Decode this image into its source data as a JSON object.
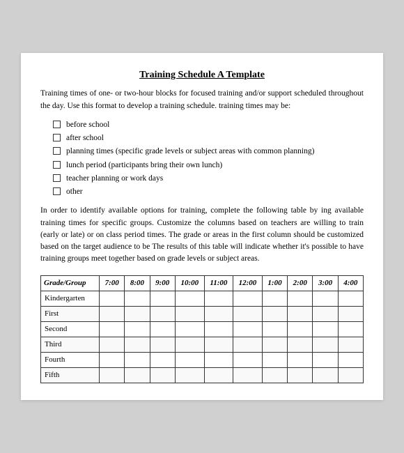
{
  "title": "Training Schedule A Template",
  "intro": "Training times of one- or two-hour blocks for focused training and/or support scheduled throughout the day. Use this format to develop a training schedule. training times may be:",
  "checklist": [
    "before school",
    "after school",
    "planning times (specific grade levels or subject areas with common planning)",
    "lunch period (participants bring their own lunch)",
    "teacher planning or work days",
    "other"
  ],
  "body": "In order to identify available options for training, complete the following table by ing available training times for specific groups. Customize the columns based on teachers are willing to train (early or late) or on class period times. The grade or areas in the first column should be customized based on the target audience to be The results of this table will indicate whether it's possible to have training groups meet together based on grade levels or subject areas.",
  "table": {
    "headers": [
      "Grade/Group",
      "7:00",
      "8:00",
      "9:00",
      "10:00",
      "11:00",
      "12:00",
      "1:00",
      "2:00",
      "3:00",
      "4:00"
    ],
    "rows": [
      "Kindergarten",
      "First",
      "Second",
      "Third",
      "Fourth",
      "Fifth"
    ]
  }
}
